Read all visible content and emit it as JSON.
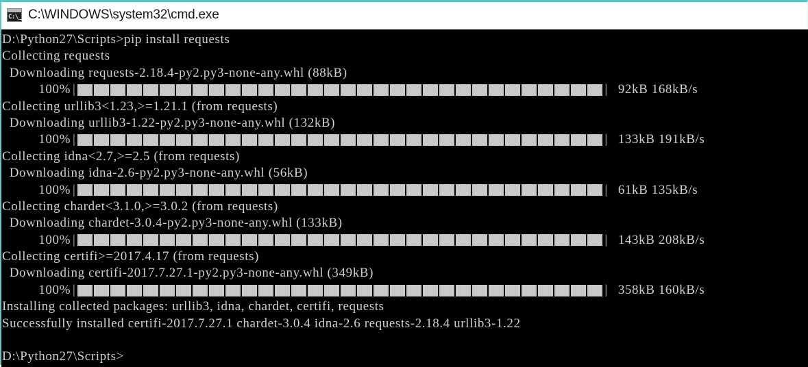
{
  "window": {
    "title": "C:\\WINDOWS\\system32\\cmd.exe",
    "icon": "cmd-icon",
    "icon_glyph": "C:\\_",
    "accent_color": "#5cc6c6",
    "titlebar_bg": "#ffffff",
    "titlebar_fg": "#1a1a1a"
  },
  "console": {
    "background": "#000000",
    "foreground": "#cfcfcf",
    "bar_block_color": "#c9c9c9",
    "lines": [
      {
        "type": "text",
        "text": "D:\\Python27\\Scripts>pip install requests"
      },
      {
        "type": "text",
        "text": "Collecting requests"
      },
      {
        "type": "text",
        "text": "  Downloading requests-2.18.4-py2.py3-none-any.whl (88kB)"
      },
      {
        "type": "progress",
        "percent": "100%",
        "blocks": 32,
        "tail": "92kB 168kB/s"
      },
      {
        "type": "text",
        "text": "Collecting urllib3<1.23,>=1.21.1 (from requests)"
      },
      {
        "type": "text",
        "text": "  Downloading urllib3-1.22-py2.py3-none-any.whl (132kB)"
      },
      {
        "type": "progress",
        "percent": "100%",
        "blocks": 32,
        "tail": "133kB 191kB/s"
      },
      {
        "type": "text",
        "text": "Collecting idna<2.7,>=2.5 (from requests)"
      },
      {
        "type": "text",
        "text": "  Downloading idna-2.6-py2.py3-none-any.whl (56kB)"
      },
      {
        "type": "progress",
        "percent": "100%",
        "blocks": 32,
        "tail": "61kB 135kB/s"
      },
      {
        "type": "text",
        "text": "Collecting chardet<3.1.0,>=3.0.2 (from requests)"
      },
      {
        "type": "text",
        "text": "  Downloading chardet-3.0.4-py2.py3-none-any.whl (133kB)"
      },
      {
        "type": "progress",
        "percent": "100%",
        "blocks": 32,
        "tail": "143kB 208kB/s"
      },
      {
        "type": "text",
        "text": "Collecting certifi>=2017.4.17 (from requests)"
      },
      {
        "type": "text",
        "text": "  Downloading certifi-2017.7.27.1-py2.py3-none-any.whl (349kB)"
      },
      {
        "type": "progress",
        "percent": "100%",
        "blocks": 32,
        "tail": "358kB 160kB/s"
      },
      {
        "type": "text",
        "text": "Installing collected packages: urllib3, idna, chardet, certifi, requests"
      },
      {
        "type": "text",
        "text": "Successfully installed certifi-2017.7.27.1 chardet-3.0.4 idna-2.6 requests-2.18.4 urllib3-1.22"
      },
      {
        "type": "blank",
        "text": " "
      },
      {
        "type": "text",
        "text": "D:\\Python27\\Scripts>"
      }
    ]
  }
}
